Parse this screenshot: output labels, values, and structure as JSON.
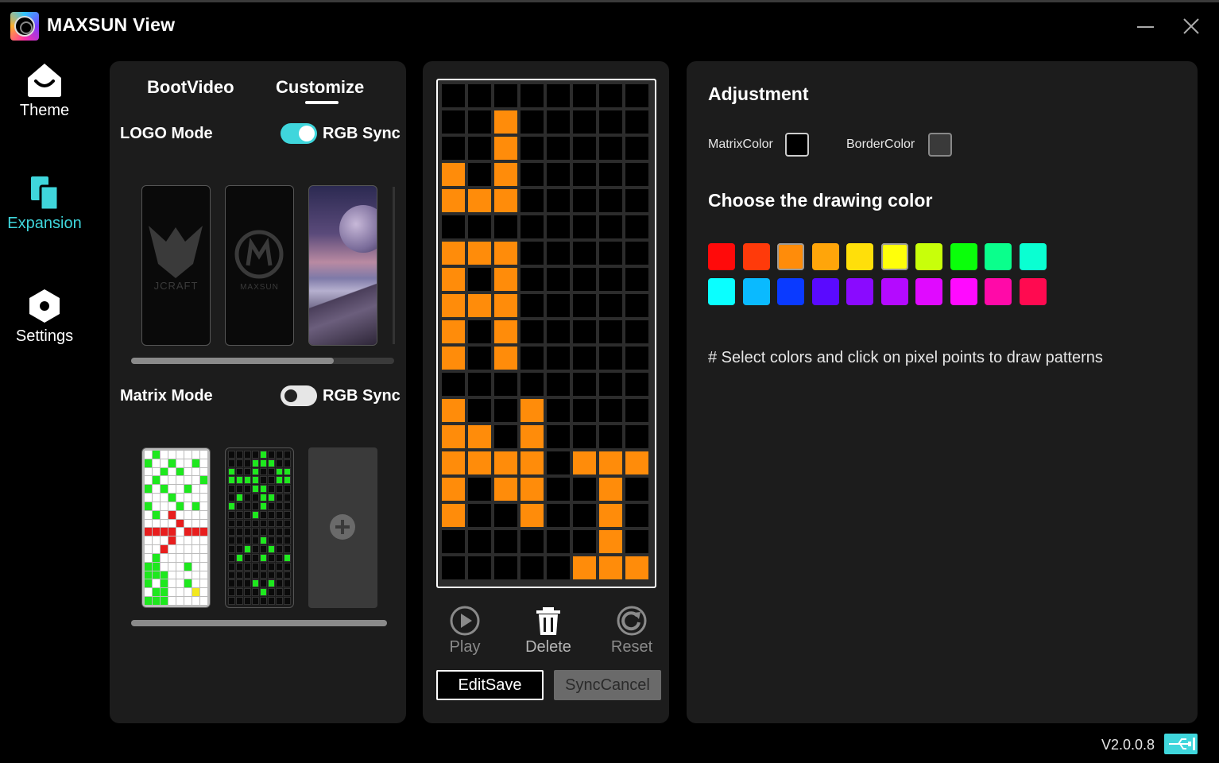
{
  "app": {
    "title": "MAXSUN View",
    "version": "V2.0.0.8"
  },
  "sidebar": {
    "items": [
      {
        "label": "Theme",
        "icon": "home-icon",
        "active": false
      },
      {
        "label": "Expansion",
        "icon": "expansion-icon",
        "active": true
      },
      {
        "label": "Settings",
        "icon": "settings-icon",
        "active": false
      }
    ]
  },
  "left_panel": {
    "tabs": [
      {
        "label": "BootVideo"
      },
      {
        "label": "Customize",
        "active": true
      }
    ],
    "logo_mode": {
      "label": "LOGO Mode",
      "rgb_sync_label": "RGB Sync",
      "rgb_sync_on": true,
      "thumbnails": [
        {
          "text": "JCRAFT",
          "icon": "jcraft-logo"
        },
        {
          "text": "MAXSUN",
          "icon": "maxsun-logo"
        },
        {
          "text": "",
          "icon": "planet-landscape-image"
        }
      ],
      "scroll_fraction": 0.77
    },
    "matrix_mode": {
      "label": "Matrix Mode",
      "rgb_sync_label": "RGB Sync",
      "rgb_sync_on": false,
      "add_icon": "plus-circle-icon"
    }
  },
  "matrix_editor": {
    "columns": 8,
    "rows": 19,
    "on_color": "#ff8c0a",
    "controls": [
      {
        "label": "Play",
        "icon": "play-icon"
      },
      {
        "label": "Delete",
        "icon": "trash-icon"
      },
      {
        "label": "Reset",
        "icon": "reset-icon"
      }
    ],
    "buttons": {
      "edit_save": "EditSave",
      "sync_cancel": "SyncCancel"
    }
  },
  "adjustment": {
    "title": "Adjustment",
    "matrix_color_label": "MatrixColor",
    "matrix_color": "#000000",
    "border_color_label": "BorderColor",
    "border_color": "#3a3a3a",
    "draw_title": "Choose the drawing color",
    "palette": [
      "#ff0a0a",
      "#ff3a0a",
      "#ff8c0a",
      "#ffa50a",
      "#ffdf0a",
      "#ffff0a",
      "#c8ff0a",
      "#0aff0a",
      "#0aff8c",
      "#0affd2",
      "#0affff",
      "#0abaff",
      "#0a3aff",
      "#5a0aff",
      "#8a0aff",
      "#b40aff",
      "#e00aff",
      "#ff0aff",
      "#ff0aa8",
      "#ff0a50"
    ],
    "selected_colors": [
      2,
      5
    ],
    "hint": "# Select colors and click on pixel points to draw patterns"
  },
  "status": {
    "usb_icon": "usb-icon"
  }
}
